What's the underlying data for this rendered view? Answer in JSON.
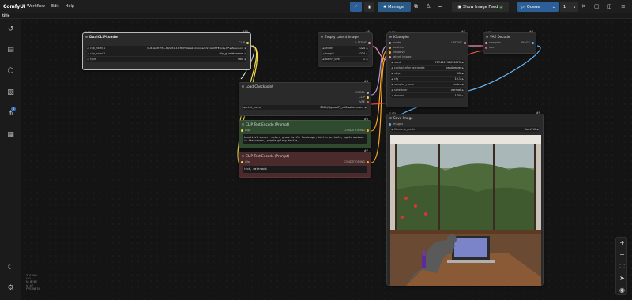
{
  "app": {
    "name": "ComfyUI"
  },
  "menu": [
    "Workflow",
    "Edit",
    "Help"
  ],
  "topbar": {
    "manager_label": "Manager",
    "image_feed_label": "Show Image Feed",
    "queue_label": "Queue",
    "queue_count": "1"
  },
  "tab": {
    "title": "title"
  },
  "sidebar": {
    "badge": "1"
  },
  "nodes": {
    "dualclip": {
      "id": "#10",
      "sub": "0.40+",
      "title": "DualCLIPLoader",
      "output": "CLIP",
      "widgets": [
        {
          "name": "clip_name1",
          "value": "CLIP-GmP-ViT-L-14/ViT-L-14-TEXT-detail-improved-hiT-GmP-TE-only-HF.safetensors"
        },
        {
          "name": "clip_name2",
          "value": "clip_g.safetensors"
        },
        {
          "name": "type",
          "value": "sdxl"
        }
      ]
    },
    "empty_latent": {
      "id": "#5",
      "title": "Empty Latent Image",
      "output": "LATENT",
      "widgets": [
        {
          "name": "width",
          "value": "1024"
        },
        {
          "name": "height",
          "value": "1024"
        },
        {
          "name": "batch_size",
          "value": "1"
        }
      ]
    },
    "ksampler": {
      "id": "#3",
      "sub": "0.30+",
      "title": "KSampler",
      "inputs": [
        "model",
        "positive",
        "negative",
        "latent_image"
      ],
      "output": "LATENT",
      "widgets": [
        {
          "name": "seed",
          "value": "787461748633470"
        },
        {
          "name": "control_after_generate",
          "value": "randomize"
        },
        {
          "name": "steps",
          "value": "40"
        },
        {
          "name": "cfg",
          "value": "10.1"
        },
        {
          "name": "sampler_name",
          "value": "euler"
        },
        {
          "name": "scheduler",
          "value": "normal"
        },
        {
          "name": "denoise",
          "value": "1.00"
        }
      ]
    },
    "vae_decode": {
      "id": "#8",
      "sub": "0.32+",
      "title": "VAE Decode",
      "inputs": [
        "samples",
        "vae"
      ],
      "output": "IMAGE"
    },
    "checkpoint": {
      "id": "#4",
      "title": "Load Checkpoint",
      "outputs": [
        "MODEL",
        "CLIP",
        "VAE"
      ],
      "widgets": [
        {
          "name": "ckpt_name",
          "value": "SDXL/SigmaVIT_v10.safetensors"
        }
      ]
    },
    "clip_pos": {
      "id": "#6",
      "title": "CLIP Text Encode (Prompt)",
      "input": "clip",
      "output": "CONDITIONING",
      "text": "beautiful scenery nature glass bottle landscape, kitten on table, apple macbook in the corner, purple galaxy bottle,"
    },
    "clip_neg": {
      "id": "#7",
      "title": "CLIP Text Encode (Prompt)",
      "input": "clip",
      "output": "CONDITIONING",
      "text": "text, watermark"
    },
    "save_image": {
      "id": "#9",
      "sub": "0.28s",
      "title": "Save Image",
      "input": "images",
      "widgets": [
        {
          "name": "filename_prefix",
          "value": "ComfyUI"
        }
      ]
    }
  },
  "stats": [
    "T: 0.00s",
    "I: 0",
    "N: 8 [8]",
    "V: 47",
    "FPS:56.50"
  ],
  "colors": {
    "accent_blue": "#2c5f97",
    "node_bg": "#2a2a2a",
    "positive_node": "#2f4a2f",
    "negative_node": "#4a2a2a",
    "wire_clip": "#f1d84b",
    "wire_model": "#b39ddb",
    "wire_latent": "#f48fb1",
    "wire_cond": "#ffa726",
    "wire_vae": "#ef5350",
    "wire_image": "#64b5f6"
  }
}
